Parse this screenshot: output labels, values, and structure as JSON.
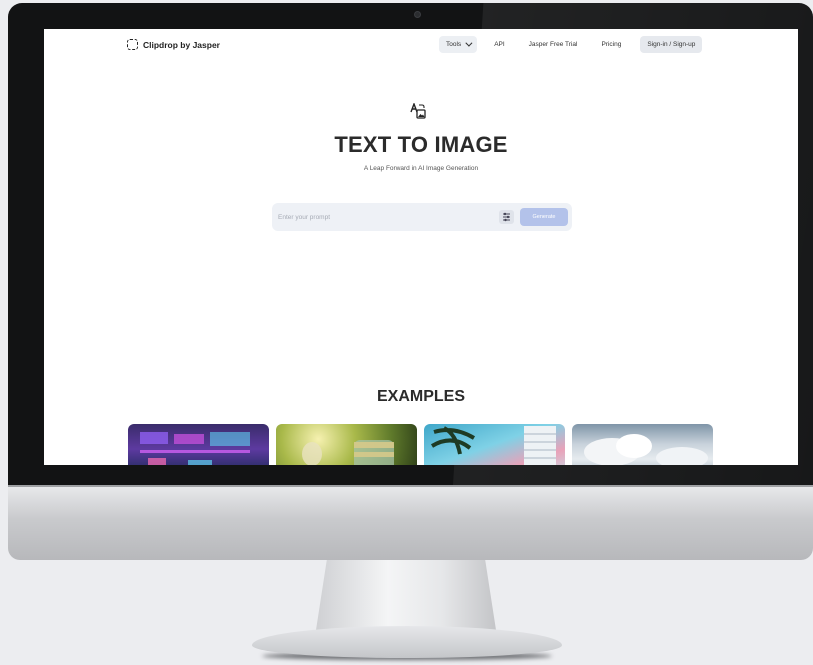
{
  "nav": {
    "logo": "Clipdrop by Jasper",
    "tools": "Tools",
    "api": "API",
    "trial": "Jasper Free Trial",
    "pricing": "Pricing",
    "signin": "Sign-in / Sign-up"
  },
  "hero": {
    "title": "TEXT TO IMAGE",
    "subtitle": "A Leap Forward in AI Image Generation"
  },
  "prompt": {
    "placeholder": "Enter your prompt",
    "value": "",
    "generate": "Generate"
  },
  "examples": {
    "title": "EXAMPLES",
    "thumbs": [
      "example-neon-interface",
      "example-coin-jar",
      "example-palm-building",
      "example-clouds"
    ]
  },
  "colors": {
    "accent": "#b3c2ea",
    "title_text": "#2b2b2b",
    "prompt_bg": "#eef1f6"
  }
}
